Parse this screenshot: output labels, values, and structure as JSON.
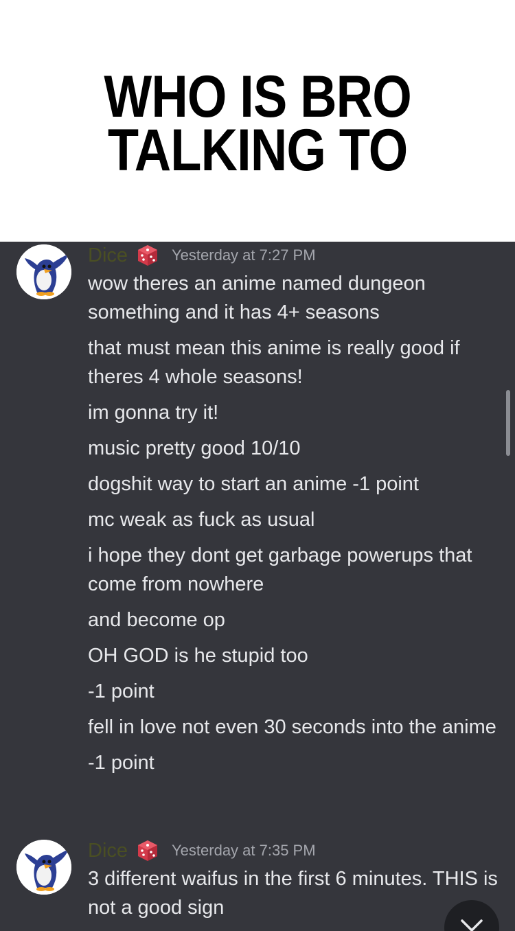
{
  "caption": {
    "line1": "WHO IS BRO",
    "line2": "TALKING TO"
  },
  "colors": {
    "chat_background": "#35363c",
    "username": "#4a4f23",
    "timestamp": "#a4a6ad",
    "message_text": "#e7e8eb"
  },
  "messages": [
    {
      "username": "Dice",
      "role_icon": "dice-icon",
      "timestamp": "Yesterday at 7:27 PM",
      "lines": [
        "wow theres an anime named dungeon something and it has 4+ seasons",
        "that must mean this anime is really good if theres 4 whole seasons!",
        "im gonna try it!",
        "music pretty good 10/10",
        "dogshit way to start an anime -1 point",
        "mc weak as fuck as usual",
        "i hope they dont get garbage powerups that come from nowhere",
        "and become op",
        "OH GOD is he stupid too",
        "-1 point",
        "fell in love not even 30 seconds into the anime",
        "-1 point"
      ]
    },
    {
      "username": "Dice",
      "role_icon": "dice-icon",
      "timestamp": "Yesterday at 7:35 PM",
      "lines": [
        "3 different waifus in the first 6 minutes. THIS is not a good sign"
      ]
    }
  ],
  "jump_button_icon": "chevron-down-icon"
}
